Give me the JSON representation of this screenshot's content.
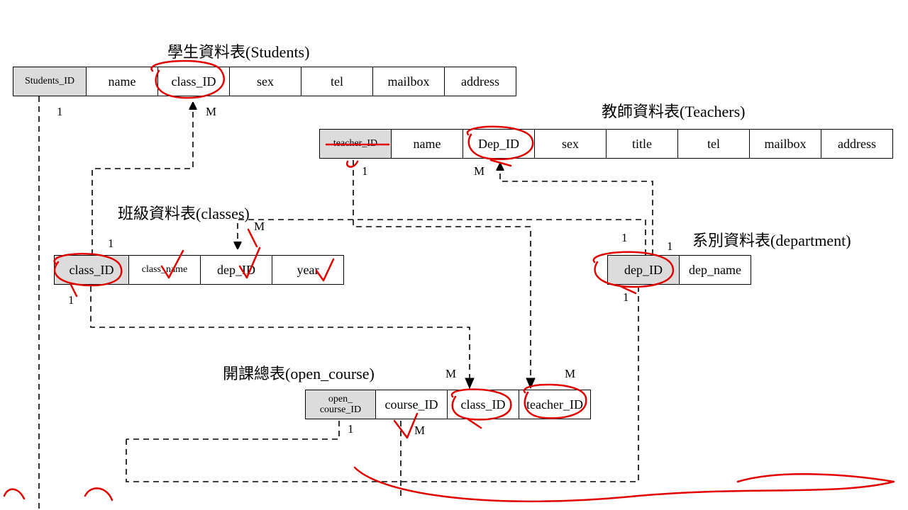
{
  "students": {
    "title": "學生資料表(Students)",
    "cols": [
      "Students_ID",
      "name",
      "class_ID",
      "sex",
      "tel",
      "mailbox",
      "address"
    ]
  },
  "teachers": {
    "title": "教師資料表(Teachers)",
    "cols": [
      "teacher_ID",
      "name",
      "Dep_ID",
      "sex",
      "title",
      "tel",
      "mailbox",
      "address"
    ]
  },
  "classes": {
    "title": "班級資料表(classes)",
    "cols": [
      "class_ID",
      "class_name",
      "dep_ID",
      "year"
    ]
  },
  "department": {
    "title": "系別資料表(department)",
    "cols": [
      "dep_ID",
      "dep_name"
    ]
  },
  "open_course": {
    "title": "開課總表(open_course)",
    "cols": [
      "open_\ncourse_ID",
      "course_ID",
      "class_ID",
      "teacher_ID"
    ]
  },
  "card": {
    "one": "1",
    "many": "M"
  }
}
